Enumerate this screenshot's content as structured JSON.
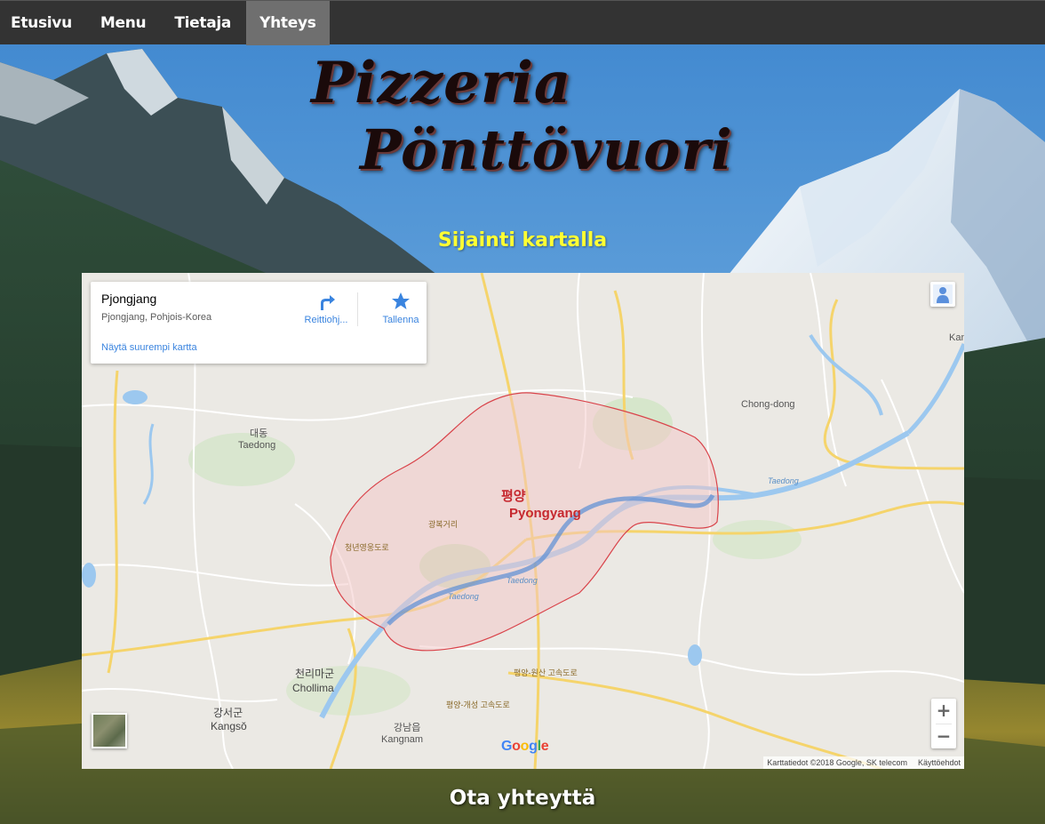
{
  "nav": {
    "items": [
      {
        "label": "Etusivu",
        "active": false
      },
      {
        "label": "Menu",
        "active": false
      },
      {
        "label": "Tietaja",
        "active": false
      },
      {
        "label": "Yhteys",
        "active": true
      }
    ]
  },
  "logo": {
    "line1": "Pizzeria",
    "line2": "Pönttövuori"
  },
  "map_section": {
    "title": "Sijainti kartalla"
  },
  "map": {
    "place_card": {
      "name": "Pjongjang",
      "address": "Pjongjang, Pohjois-Korea",
      "directions_label": "Reittiohj...",
      "save_label": "Tallenna",
      "larger_map_link": "Näytä suurempi kartta"
    },
    "zoom_in": "+",
    "zoom_out": "−",
    "google": "Google",
    "attribution": "Karttatiedot ©2018 Google, SK telecom",
    "terms": "Käyttöehdot",
    "labels": {
      "city_ko": "평양",
      "city_en": "Pyongyang",
      "taedong_ko": "대동",
      "taedong_en": "Taedong",
      "chollima_ko": "천리마군",
      "chollima_en": "Chollima",
      "kangso_ko": "강서군",
      "kangso_en": "Kangsŏ",
      "kangnam_ko": "강남읍",
      "kangnam_en": "Kangnam",
      "chong_dong": "Chong-dong",
      "river_taedong_1": "Taedong",
      "river_taedong_2": "Taedong",
      "river_taedong_3": "Taedong",
      "kan_edge": "Kan",
      "road_1": "평양-원산 고속도로",
      "road_2": "평양-개성 고속도로",
      "road_3": "청년영웅도로",
      "road_4": "광복거리"
    }
  },
  "contact_section": {
    "title": "Ota yhteyttä"
  },
  "colors": {
    "nav_bg": "#333333",
    "nav_active": "#6f6f6f",
    "map_title": "#ffff33",
    "city_highlight": "#c6282f",
    "link_blue": "#3a84df"
  }
}
